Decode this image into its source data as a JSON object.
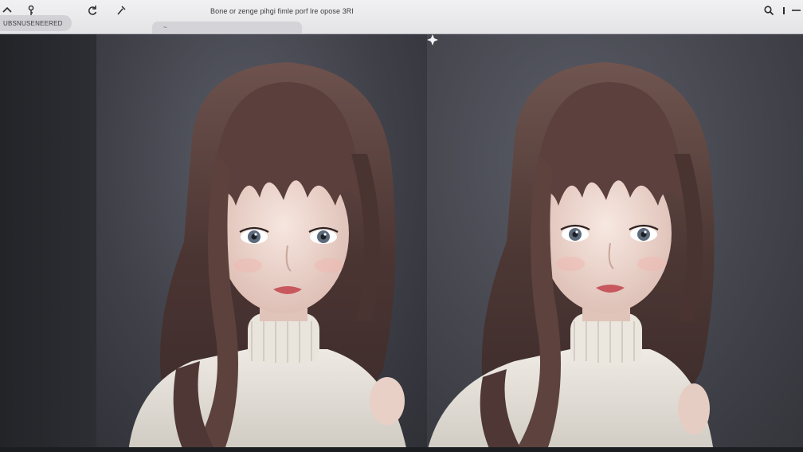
{
  "toolbar": {
    "title": "Bone or zenge pihgi fimle porf lre opose 3RI",
    "left_pill": "UBSNUSENEERED",
    "address_text": "~",
    "icons": [
      "chevron-up-icon",
      "key-icon",
      "refresh-icon",
      "tools-icon",
      "search-icon",
      "info-icon",
      "minimize-icon"
    ]
  },
  "main": {
    "panels": [
      {
        "name": "portrait-left"
      },
      {
        "name": "portrait-right"
      }
    ],
    "sparkle_icon": "sparkle-icon"
  },
  "colors": {
    "toolbar_bg": "#e8e8eb",
    "canvas_bg": "#2b2c31",
    "hair": "#5a3f3c",
    "skin": "#efd9d2",
    "sweater": "#e6e1da",
    "lips": "#c7585d"
  }
}
